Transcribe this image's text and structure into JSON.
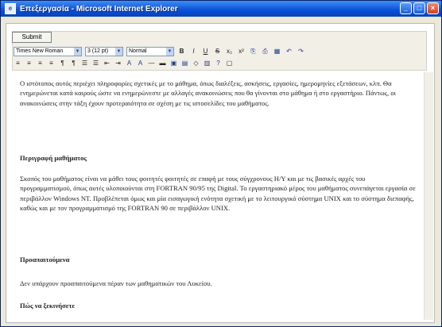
{
  "window": {
    "title": "Επεξεργασία - Microsoft Internet Explorer",
    "minimize": "_",
    "maximize": "□",
    "close": "×"
  },
  "form": {
    "submit_label": "Submit"
  },
  "toolbar": {
    "font_family": "Times New Roman",
    "font_size": "3 (12 pt)",
    "format": "Normal",
    "row1_icons": [
      "B",
      "I",
      "U",
      "S",
      "x₂",
      "x²",
      "⎘",
      "⎙",
      "▦",
      "↶",
      "↷"
    ],
    "row2_icons": [
      "≡",
      "≡",
      "≡",
      "≡",
      "¶",
      "¶",
      "☰",
      "☰",
      "⇤",
      "⇥",
      "A",
      "A",
      "—",
      "▬",
      "▣",
      "▤",
      "◇",
      "▥",
      "?",
      "▢"
    ]
  },
  "content": {
    "paragraph1": "Ο ιστότοπος αυτός περιέχει πληροφορίες σχετικές με το μάθημα, όπως διαλέξεις, ασκήσεις, εργασίες, ημερομηνίες εξετάσεων, κλπ. Θα ενημερώνεται κατά καιρούς ώστε να ενημερώνεστε με αλλαγές ανακοινώσεις που θα γίνονται στο μάθημα ή στο εργαστήριο. Πάντως, οι ανακοινώσεις στην τάξη έχουν προτεραιότητα σε σχέση με τις ιστοσελίδες του μαθήματος.",
    "heading1": "Περιγραφή μαθήματος",
    "paragraph2": "Σκοπός του μαθήματος είναι να μάθει τους φοιτητές φοιτητές σε επαφή με τους σύγχρονους Η/Υ και με τις βασικές αρχές του προγραμματισμού, όπως αυτές υλοποιούνται στη FORTRAN 90/95 της Digital. Το εργαστηριακό μέρος του μαθήματος συνεπάγεται εργασία σε περιβάλλον Windows NT. Προβλέπεται όμως και μία εισαγωγική ενότητα σχετική με το λειτουργικό σύστημα UNIX και το σύστημα διεπαφής, καθώς και με τον προγραμματισμό της FORTRAN 90 σε περιβάλλον UNIX.",
    "heading2": "Προαπαιτούμενα",
    "paragraph3": "Δεν υπάρχουν προαπαιτούμενα πέραν των μαθηματικών του Λυκείου.",
    "heading3": "Πώς να ξεκινήσετε"
  }
}
